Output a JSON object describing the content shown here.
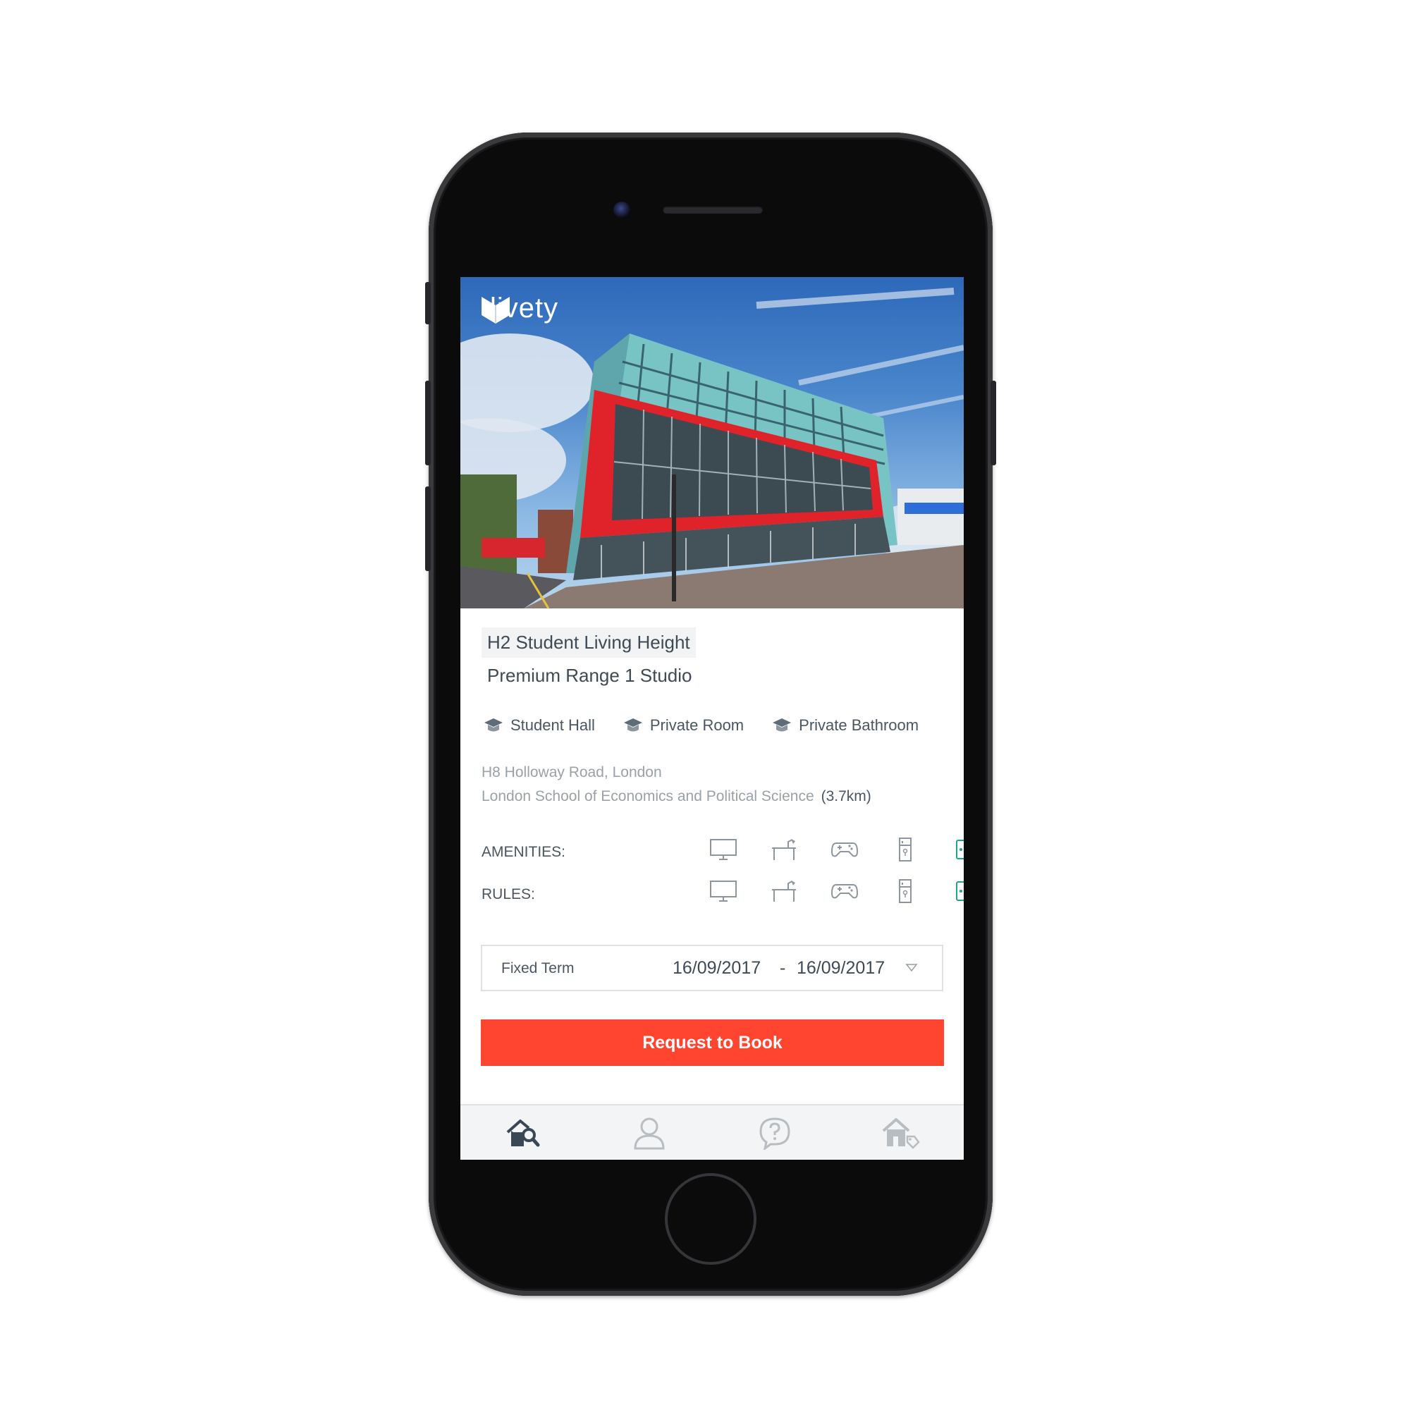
{
  "brand": {
    "logo_text": "livety"
  },
  "listing": {
    "title": "H2 Student Living Height",
    "subtitle": "Premium Range 1 Studio",
    "features": [
      {
        "label": "Student Hall",
        "icon": "graduation-cap-icon"
      },
      {
        "label": "Private Room",
        "icon": "graduation-cap-icon"
      },
      {
        "label": "Private Bathroom",
        "icon": "graduation-cap-icon"
      }
    ],
    "address": "H8 Holloway Road, London",
    "school": "London School of Economics and Political Science",
    "distance": "(3.7km)"
  },
  "amenities": {
    "label": "AMENITIES:",
    "icons": [
      "monitor-icon",
      "desk-lamp-icon",
      "gamepad-icon",
      "fridge-icon",
      "more-icon"
    ]
  },
  "rules": {
    "label": "RULES:",
    "icons": [
      "monitor-icon",
      "desk-lamp-icon",
      "gamepad-icon",
      "fridge-icon",
      "more-icon"
    ]
  },
  "term": {
    "label": "Fixed Term",
    "from": "16/09/2017",
    "separator": "-",
    "to": "16/09/2017"
  },
  "cta": {
    "label": "Request to Book"
  },
  "tabbar": {
    "tabs": [
      {
        "icon": "home-search-icon",
        "active": true
      },
      {
        "icon": "user-icon",
        "active": false
      },
      {
        "icon": "help-chat-icon",
        "active": false
      },
      {
        "icon": "home-tag-icon",
        "active": false
      }
    ]
  },
  "colors": {
    "accent": "#ff4530",
    "teal": "#1fa58b",
    "text_dark": "#3f4a57",
    "text_muted": "#9aa1a8",
    "tab_active": "#3a4755",
    "tab_inactive": "#b8bdc2"
  }
}
